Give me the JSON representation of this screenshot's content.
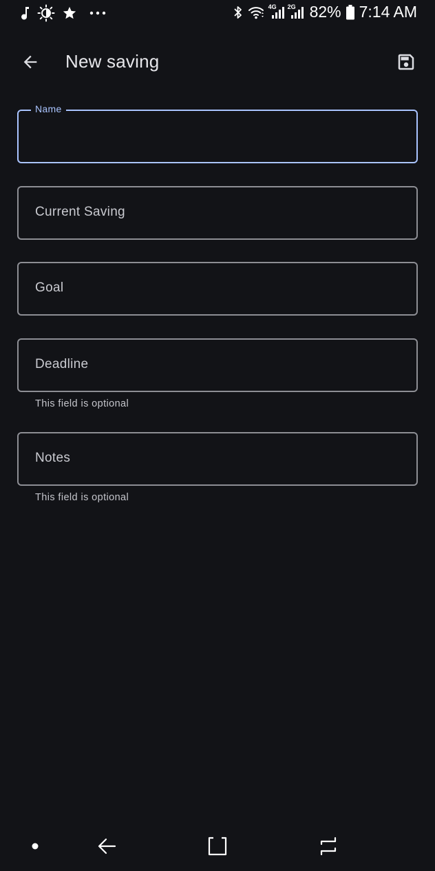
{
  "status_bar": {
    "left_icons": [
      "music-note-icon",
      "brightness-icon",
      "star-icon",
      "more-dots-icon"
    ],
    "right_icons": [
      "bluetooth-icon",
      "wifi-icon",
      "signal-4g-icon",
      "signal-2g-icon",
      "battery-icon"
    ],
    "battery_percent": "82%",
    "time": "7:14 AM",
    "network_4g": "4G",
    "network_2g": "2G"
  },
  "app_bar": {
    "title": "New saving",
    "back_icon": "arrow-back-icon",
    "save_icon": "save-icon"
  },
  "form": {
    "name": {
      "label": "Name",
      "value": "",
      "focused": true
    },
    "current_saving": {
      "label": "Current Saving"
    },
    "goal": {
      "label": "Goal"
    },
    "deadline": {
      "label": "Deadline",
      "helper": "This field is optional"
    },
    "notes": {
      "label": "Notes",
      "helper": "This field is optional"
    }
  },
  "colors": {
    "background": "#121317",
    "accent": "#aac4ff",
    "outline": "#8d8e94",
    "text": "#e6e6ea"
  },
  "nav_bar": {
    "items": [
      "dot-icon",
      "nav-back-icon",
      "recents-icon",
      "overview-icon"
    ]
  }
}
